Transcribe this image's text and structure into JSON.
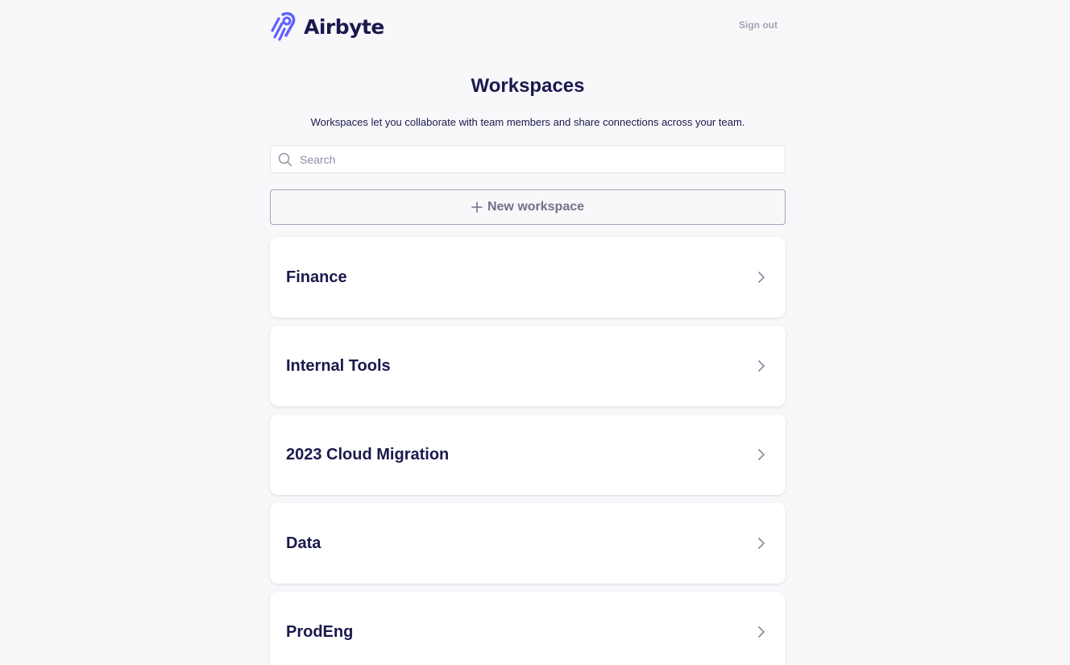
{
  "brand": {
    "name": "Airbyte",
    "logo_icon": "airbyte-logo-icon",
    "accent_color": "#615eff"
  },
  "header": {
    "sign_out_label": "Sign out"
  },
  "main": {
    "title": "Workspaces",
    "subtitle": "Workspaces let you collaborate with team members and share connections across your team.",
    "search": {
      "placeholder": "Search",
      "value": "",
      "icon": "search-icon"
    },
    "new_workspace": {
      "label": "New workspace",
      "icon": "plus-icon"
    },
    "workspaces": [
      {
        "name": "Finance"
      },
      {
        "name": "Internal Tools"
      },
      {
        "name": "2023 Cloud Migration"
      },
      {
        "name": "Data"
      },
      {
        "name": "ProdEng"
      }
    ],
    "row_icon": "chevron-right-icon"
  },
  "colors": {
    "background": "#f8f8fa",
    "text_primary": "#1a194d",
    "text_muted": "#717189",
    "card": "#ffffff"
  }
}
